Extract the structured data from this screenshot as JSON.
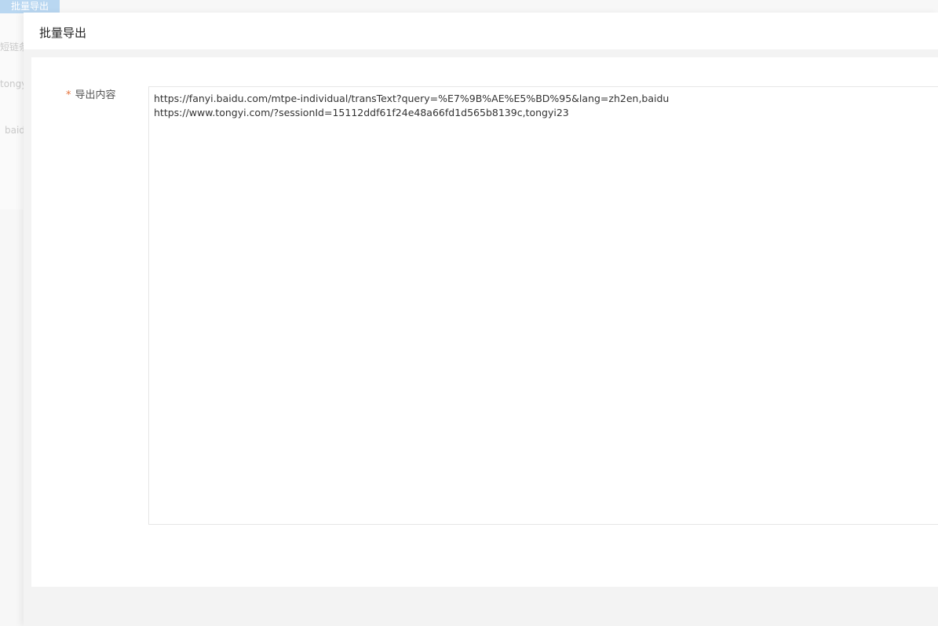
{
  "background": {
    "button_label": "批量导出",
    "fragments": [
      "短链条",
      "tongy",
      "baid"
    ]
  },
  "drawer": {
    "title": "批量导出",
    "form": {
      "required_mark": "*",
      "label": "导出内容",
      "value": "https://fanyi.baidu.com/mtpe-individual/transText?query=%E7%9B%AE%E5%BD%95&lang=zh2en,baidu\nhttps://www.tongyi.com/?sessionId=15112ddf61f24e48a66fd1d565b8139c,tongyi23"
    }
  },
  "colors": {
    "accent": "#b9d7f1",
    "required": "#e6733c",
    "border": "#e6e6e6"
  }
}
